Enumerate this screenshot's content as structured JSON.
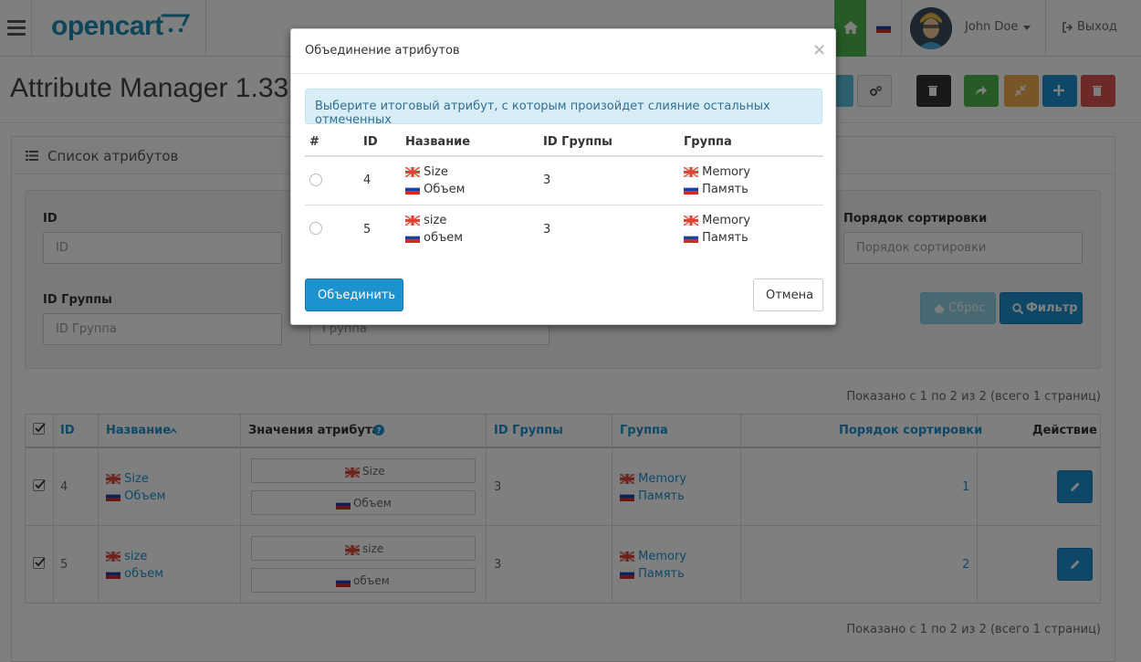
{
  "header": {
    "logo_text": "opencart",
    "user_name": "John Doe",
    "logout_label": "Выход"
  },
  "page": {
    "title": "Attribute Manager 1.33"
  },
  "panel": {
    "title": "Список атрибутов"
  },
  "filters": {
    "id_label": "ID",
    "id_placeholder": "ID",
    "group_id_label": "ID Группы",
    "group_id_placeholder": "ID Группа",
    "group_placeholder": "Группа",
    "sort_label": "Порядок сортировки",
    "sort_placeholder": "Порядок сортировки",
    "reset_label": "Сброс",
    "filter_label": "Фильтр"
  },
  "pagination": {
    "top_text": "Показано с 1 по 2 из 2 (всего 1 страниц)",
    "bottom_text": "Показано с 1 по 2 из 2 (всего 1 страниц)"
  },
  "table": {
    "headers": {
      "id": "ID",
      "name": "Название",
      "values": "Значения атрибута",
      "group_id": "ID Группы",
      "group": "Группа",
      "sort": "Порядок сортировки",
      "action": "Действие"
    },
    "rows": [
      {
        "id": "4",
        "name_en": "Size",
        "name_ru": "Объем",
        "value_en": "Size",
        "value_ru": "Объем",
        "group_id": "3",
        "group_en": "Memory",
        "group_ru": "Память",
        "sort": "1"
      },
      {
        "id": "5",
        "name_en": "size",
        "name_ru": "объем",
        "value_en": "size",
        "value_ru": "объем",
        "group_id": "3",
        "group_en": "Memory",
        "group_ru": "Память",
        "sort": "2"
      }
    ]
  },
  "modal": {
    "title": "Объединение атрибутов",
    "close": "×",
    "alert": "Выберите итоговый атрибут, с которым произойдет слияние остальных отмеченных",
    "headers": {
      "num": "#",
      "id": "ID",
      "name": "Название",
      "group_id": "ID Группы",
      "group": "Группа"
    },
    "rows": [
      {
        "id": "4",
        "name_en": "Size",
        "name_ru": "Объем",
        "group_id": "3",
        "group_en": "Memory",
        "group_ru": "Память"
      },
      {
        "id": "5",
        "name_en": "size",
        "name_ru": "объем",
        "group_id": "3",
        "group_en": "Memory",
        "group_ru": "Память"
      }
    ],
    "merge_label": "Объединить",
    "cancel_label": "Отмена"
  },
  "colors": {
    "primary": "#1e91cf",
    "success": "#4cb64c",
    "warning": "#f0ad4e",
    "danger": "#d9534f",
    "info": "#5bc0de",
    "dark": "#333333"
  }
}
